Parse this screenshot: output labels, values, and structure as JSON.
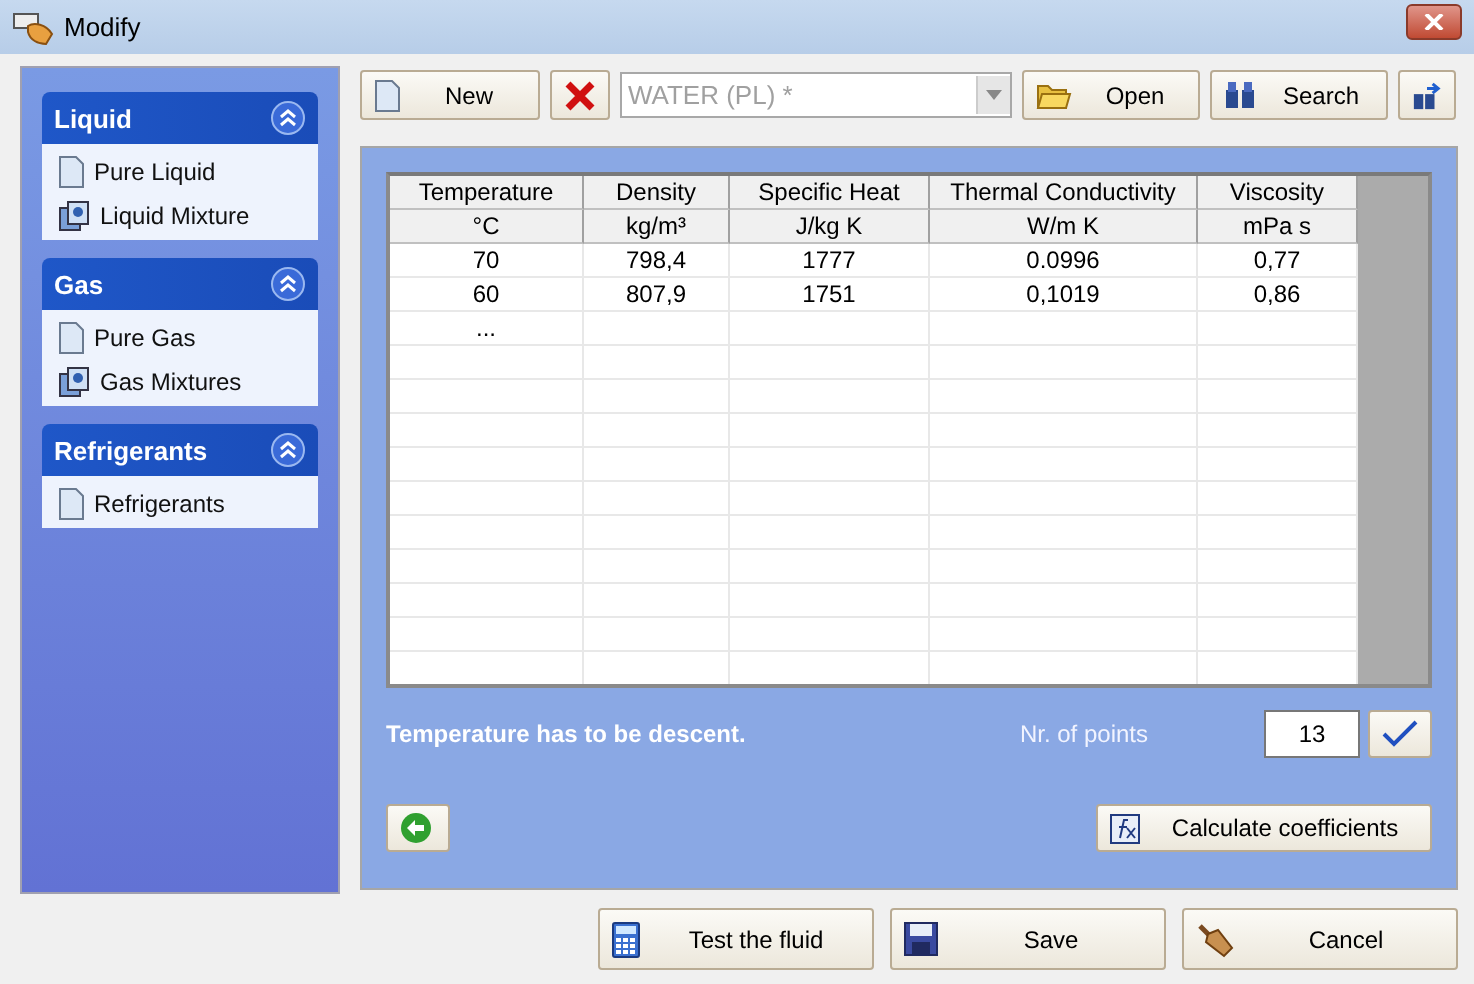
{
  "window": {
    "title": "Modify"
  },
  "sidebar": {
    "groups": [
      {
        "title": "Liquid",
        "expanded": true,
        "items": [
          {
            "label": "Pure Liquid",
            "kind": "pure"
          },
          {
            "label": "Liquid Mixture",
            "kind": "mixture"
          }
        ]
      },
      {
        "title": "Gas",
        "expanded": true,
        "items": [
          {
            "label": "Pure Gas",
            "kind": "pure"
          },
          {
            "label": "Gas Mixtures",
            "kind": "mixture"
          }
        ]
      },
      {
        "title": "Refrigerants",
        "expanded": true,
        "items": [
          {
            "label": "Refrigerants",
            "kind": "pure"
          }
        ]
      }
    ]
  },
  "toolbar": {
    "new_button": "New",
    "fluid_combo": {
      "value": "WATER (PL) *",
      "disabled": true
    },
    "open_button": "Open",
    "search_button": "Search"
  },
  "table": {
    "columns": [
      {
        "name": "Temperature",
        "unit": "°C"
      },
      {
        "name": "Density",
        "unit": "kg/m³"
      },
      {
        "name": "Specific Heat",
        "unit": "J/kg K"
      },
      {
        "name": "Thermal Conductivity",
        "unit": "W/m K"
      },
      {
        "name": "Viscosity",
        "unit": "mPa s"
      }
    ],
    "rows": [
      [
        "70",
        "798,4",
        "1777",
        "0.0996",
        "0,77"
      ],
      [
        "60",
        "807,9",
        "1751",
        "0,1019",
        "0,86"
      ],
      [
        "...",
        "",
        "",
        "",
        ""
      ]
    ]
  },
  "message": "Temperature has to be descent.",
  "points": {
    "label": "Nr. of points",
    "value": "13"
  },
  "calculate_button": "Calculate coefficients",
  "footer_buttons": [
    {
      "label": "Test the fluid",
      "kind": "test"
    },
    {
      "label": "Save",
      "kind": "save"
    },
    {
      "label": "Cancel",
      "kind": "cancel"
    }
  ]
}
